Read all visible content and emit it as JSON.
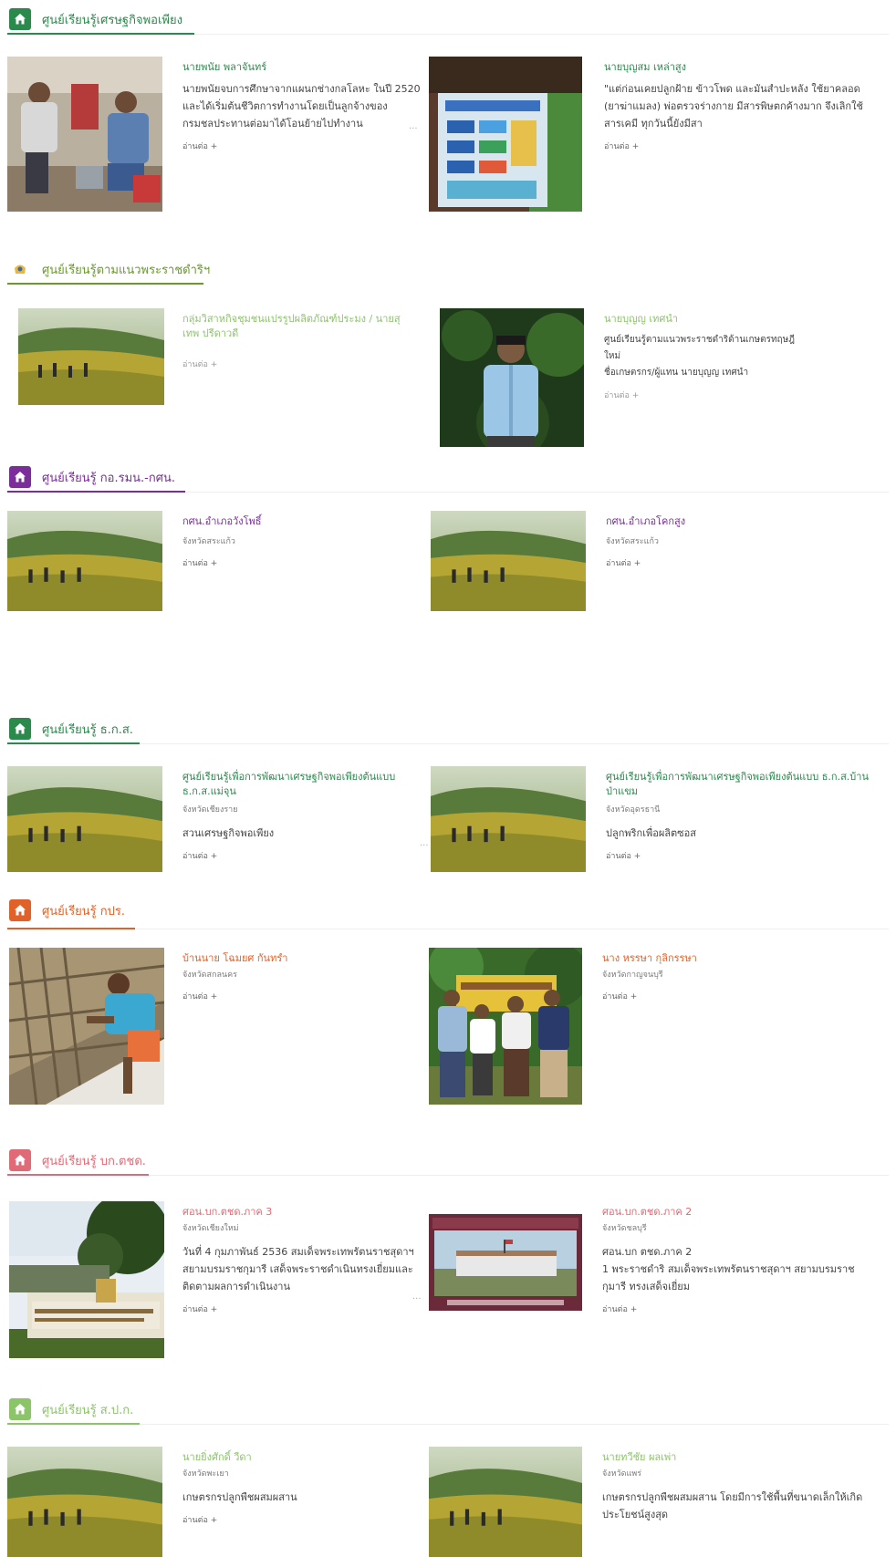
{
  "more_label": "อ่านต่อ +",
  "sections": [
    {
      "key": "s1",
      "color": "#2a8a4b",
      "title": "ศูนย์เรียนรู้เศรษฐกิจพอเพียง",
      "cards": [
        {
          "title": "นายพนัย พลาจันทร์",
          "desc": "นายพนัยจบการศึกษาจากแผนกช่างกลโลหะ ในปี 2520 และได้เริ่มต้นชีวิตการทำงานโดยเป็นลูกจ้างของกรมชลประทานต่อมาได้โอนย้ายไปทำงาน"
        },
        {
          "title": "นายบุญสม เหล่าสูง",
          "desc": "\"แต่ก่อนเคยปลูกฝ้าย ข้าวโพด และมันสำปะหลัง ใช้ยาคลอด (ยาฆ่าแมลง) พ่อตรวจร่างกาย มีสารพิษตกค้างมาก จึงเลิกใช้สารเคมี ทุกวันนี้ยังมีสา"
        }
      ]
    },
    {
      "key": "s2",
      "color": "#6a9a2a",
      "title": "ศูนย์เรียนรู้ตามแนวพระราชดำริฯ",
      "cards": [
        {
          "title": "กลุ่มวิสาหกิจชุมชนแปรรูปผลิตภัณฑ์ประมง / นายสุเทพ ปรีดาวดี",
          "desc": ""
        },
        {
          "title": "นายบุญญ เทศนำ",
          "desc": "ศูนย์เรียนรู้ตามแนวพระราชดำริด้านเกษตรทฤษฎีใหม่\nชื่อเกษตรกร/ผู้แทน นายบุญญ เทศนำ"
        }
      ]
    },
    {
      "key": "s3",
      "color": "#7b2d9a",
      "title": "ศูนย์เรียนรู้ กอ.รมน.-กศน.",
      "cards": [
        {
          "title": "กศน.อำเภอวังโพธิ์",
          "sub": "จังหวัดสระแก้ว"
        },
        {
          "title": "กศน.อำเภอโคกสูง",
          "sub": "จังหวัดสระแก้ว"
        }
      ]
    },
    {
      "key": "s4",
      "color": "#2a8a4b",
      "title": "ศูนย์เรียนรู้ ธ.ก.ส.",
      "cards": [
        {
          "title": "ศูนย์เรียนรู้เพื่อการพัฒนาเศรษฐกิจพอเพียงต้นแบบ ธ.ก.ส.แม่จุน",
          "sub": "จังหวัดเชียงราย",
          "desc": "สวนเศรษฐกิจพอเพียง"
        },
        {
          "title": "ศูนย์เรียนรู้เพื่อการพัฒนาเศรษฐกิจพอเพียงต้นแบบ ธ.ก.ส.บ้านป่าแขม",
          "sub": "จังหวัดอุดรธานี",
          "desc": "ปลูกพริกเพื่อผลิตซอส"
        }
      ]
    },
    {
      "key": "s5",
      "color": "#e0622a",
      "title": "ศูนย์เรียนรู้ กปร.",
      "cards": [
        {
          "title": "บ้านนาย โฉมยศ กันทรำ",
          "sub": "จังหวัดสกลนคร"
        },
        {
          "title": "นาง หรรษา กุลิกรรษา",
          "sub": "จังหวัดกาญจนบุรี"
        }
      ]
    },
    {
      "key": "s6",
      "color": "#e06a75",
      "title": "ศูนย์เรียนรู้ บก.ตชด.",
      "cards": [
        {
          "title": "ศอน.บก.ตชด.ภาค 3",
          "sub": "จังหวัดเชียงใหม่",
          "desc": "วันที่ 4 กุมภาพันธ์ 2536 สมเด็จพระเทพรัตนราชสุดาฯ สยามบรมราชกุมารี เสด็จพระราชดำเนินทรงเยี่ยมและติดตามผลการดำเนินงาน"
        },
        {
          "title": "ศอน.บก.ตชด.ภาค 2",
          "sub": "จังหวัดชลบุรี",
          "desc": "ศอน.บก ตชด.ภาค 2\n1  พระราชดำริ สมเด็จพระเทพรัตนราชสุดาฯ สยามบรมราชกุมารี ทรงเสด็จเยี่ยม"
        }
      ]
    },
    {
      "key": "s7",
      "color": "#8cc46a",
      "title": "ศูนย์เรียนรู้ ส.ป.ก.",
      "cards": [
        {
          "title": "นายยิ่งศักดิ์ วีดา",
          "sub": "จังหวัดพะเยา",
          "desc": "เกษตรกรปลูกพืชผสมผสาน"
        },
        {
          "title": "นายทวีชัย ผลเพ่า",
          "sub": "จังหวัดแพร่",
          "desc": "เกษตรกรปลูกพืชผสมผสาน โดยมีการใช้พื้นที่ขนาดเล็กให้เกิดประโยชน์สูงสุด"
        }
      ]
    }
  ]
}
